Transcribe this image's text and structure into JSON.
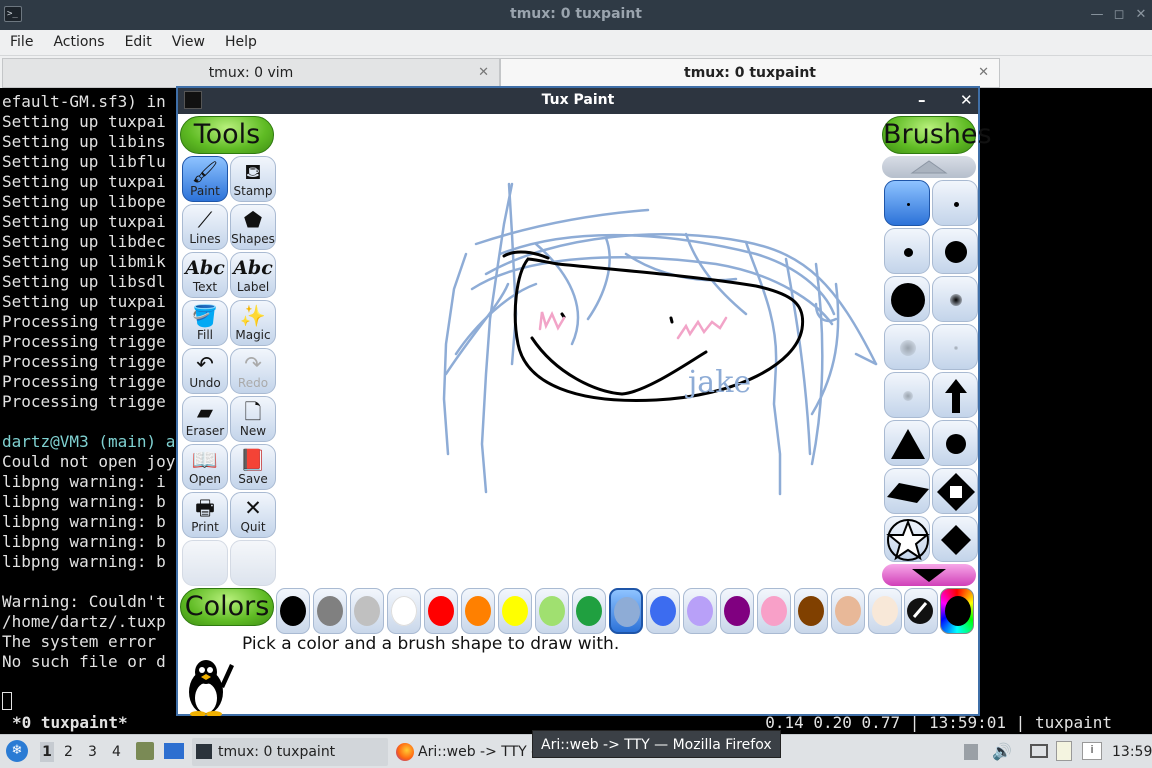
{
  "window": {
    "title": "tmux: 0 tuxpaint"
  },
  "menu": [
    "File",
    "Actions",
    "Edit",
    "View",
    "Help"
  ],
  "tabs": [
    {
      "label": "tmux: 0 vim",
      "active": false
    },
    {
      "label": "tmux: 0 tuxpaint",
      "active": true
    }
  ],
  "terminal": {
    "lines": [
      "efault-GM.sf3) in",
      "Setting up tuxpai",
      "Setting up libins",
      "Setting up libflu",
      "Setting up tuxpai",
      "Setting up libope",
      "Setting up tuxpai",
      "Setting up libdec",
      "Setting up libmik",
      "Setting up libsdl",
      "Setting up tuxpai",
      "Processing trigge",
      "Processing trigge",
      "Processing trigge",
      "Processing trigge",
      "Processing trigge",
      "",
      "dartz@VM3 (main) a",
      "Could not open joy",
      "libpng warning: i",
      "libpng warning: b",
      "libpng warning: b",
      "libpng warning: b",
      "libpng warning: b",
      "",
      "Warning: Couldn't",
      "/home/dartz/.tuxp",
      "The system error ",
      "No such file or d"
    ],
    "prompt_user": "dartz"
  },
  "tmux_status": {
    "left": "*0 tuxpaint*",
    "right": "0.14 0.20 0.77 | 13:59:01 | tuxpaint"
  },
  "tuxpaint": {
    "title": "Tux Paint",
    "tools_header": "Tools",
    "brushes_header": "Brushes",
    "colors_header": "Colors",
    "tools": [
      {
        "label": "Paint",
        "icon": "paintbrush-icon",
        "glyph": "🖌",
        "selected": true,
        "disabled": false
      },
      {
        "label": "Stamp",
        "icon": "stamp-icon",
        "glyph": "⛾",
        "selected": false,
        "disabled": false
      },
      {
        "label": "Lines",
        "icon": "lines-icon",
        "glyph": "⟋",
        "selected": false,
        "disabled": false
      },
      {
        "label": "Shapes",
        "icon": "pentagon-icon",
        "glyph": "⬟",
        "selected": false,
        "disabled": false
      },
      {
        "label": "Text",
        "icon": "text-icon",
        "glyph": "Abc",
        "selected": false,
        "disabled": false
      },
      {
        "label": "Label",
        "icon": "label-icon",
        "glyph": "Abc",
        "selected": false,
        "disabled": false
      },
      {
        "label": "Fill",
        "icon": "paint-bucket-icon",
        "glyph": "🪣",
        "selected": false,
        "disabled": false
      },
      {
        "label": "Magic",
        "icon": "magic-wand-icon",
        "glyph": "✨",
        "selected": false,
        "disabled": false
      },
      {
        "label": "Undo",
        "icon": "undo-icon",
        "glyph": "↶",
        "selected": false,
        "disabled": false
      },
      {
        "label": "Redo",
        "icon": "redo-icon",
        "glyph": "↷",
        "selected": false,
        "disabled": true
      },
      {
        "label": "Eraser",
        "icon": "eraser-icon",
        "glyph": "▰",
        "selected": false,
        "disabled": false
      },
      {
        "label": "New",
        "icon": "new-page-icon",
        "glyph": "🗋",
        "selected": false,
        "disabled": false
      },
      {
        "label": "Open",
        "icon": "open-book-icon",
        "glyph": "📖",
        "selected": false,
        "disabled": false
      },
      {
        "label": "Save",
        "icon": "save-book-icon",
        "glyph": "📕",
        "selected": false,
        "disabled": false
      },
      {
        "label": "Print",
        "icon": "printer-icon",
        "glyph": "🖶",
        "selected": false,
        "disabled": false
      },
      {
        "label": "Quit",
        "icon": "quit-x-icon",
        "glyph": "✕",
        "selected": false,
        "disabled": false
      }
    ],
    "colors": [
      "#000000",
      "#808080",
      "#c0c0c0",
      "#ffffff",
      "#ff0000",
      "#ff8000",
      "#ffff00",
      "#a0e070",
      "#20a040",
      "#8eacd6",
      "#3c6cf0",
      "#b8a0f8",
      "#800080",
      "#f8a0c8",
      "#804000",
      "#e8b898",
      "#f8e8d8"
    ],
    "selected_color": "#8eacd6",
    "drawing_text": "jake",
    "status_message": "Pick a color and a brush shape to draw with."
  },
  "taskbar": {
    "workspaces": [
      "1",
      "2",
      "3",
      "4"
    ],
    "tasks": [
      "tmux: 0 tuxpaint",
      "Ari::web -> TTY -..."
    ],
    "tooltip": "Ari::web -> TTY — Mozilla Firefox",
    "clock": "13:59"
  }
}
